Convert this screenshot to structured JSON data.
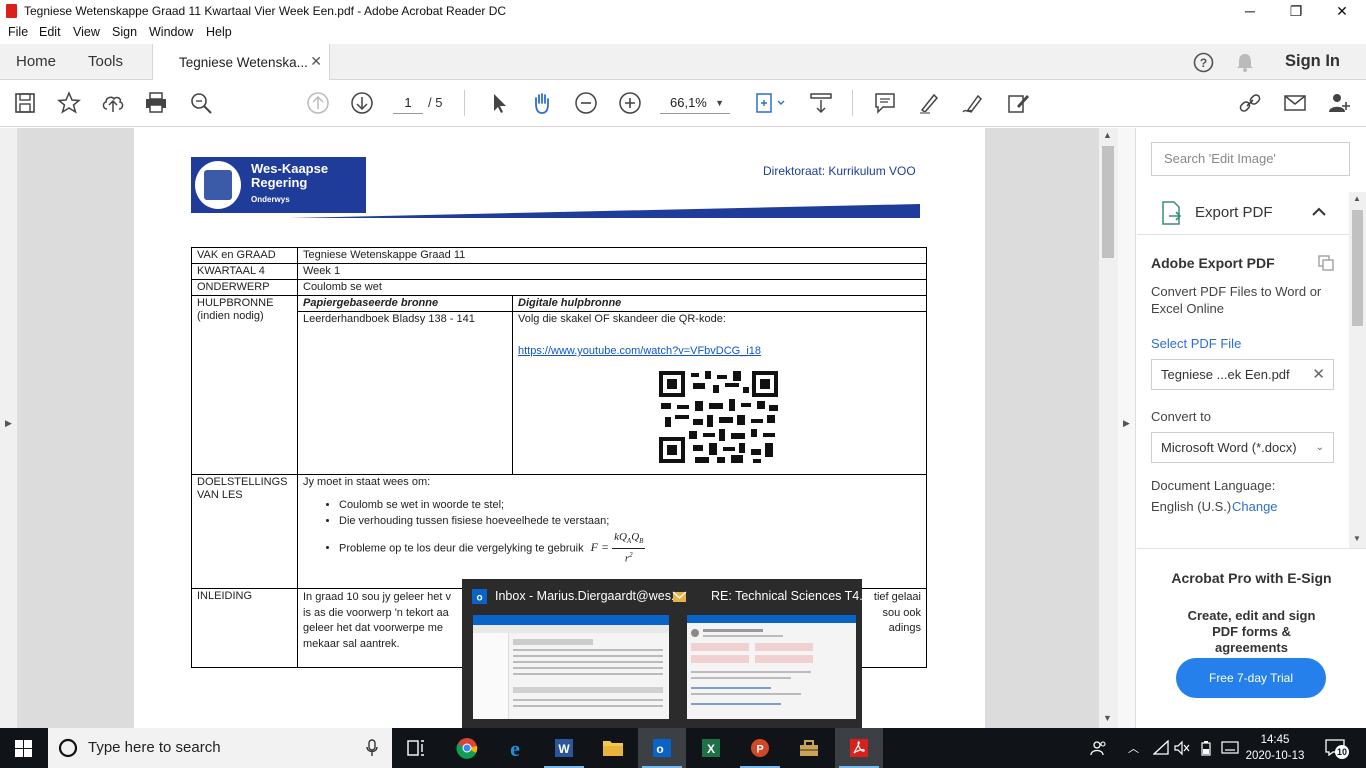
{
  "window": {
    "title": "Tegniese Wetenskappe Graad 11 Kwartaal Vier Week Een.pdf - Adobe Acrobat Reader DC",
    "minimize": "─",
    "maximize": "❐",
    "close": "✕"
  },
  "menu": [
    "File",
    "Edit",
    "View",
    "Sign",
    "Window",
    "Help"
  ],
  "tabs": {
    "home": "Home",
    "tools": "Tools",
    "doc": "Tegniese Wetenska...",
    "doc_close": "✕",
    "sign_in": "Sign In"
  },
  "toolbar": {
    "page_current": "1",
    "page_total": "/ 5",
    "zoom": "66,1%"
  },
  "pdf": {
    "logo_line1": "Wes-Kaapse",
    "logo_line2": "Regering",
    "logo_line3": "Onderwys",
    "directorate": "Direktoraat: Kurrikulum VOO",
    "rows": {
      "vak_label": "VAK en GRAAD",
      "vak_value": "Tegniese Wetenskappe Graad 11",
      "kwartaal_label": "KWARTAAL 4",
      "kwartaal_value": "Week 1",
      "onderwerp_label": "ONDERWERP",
      "onderwerp_value": "Coulomb se wet",
      "hulp_label1": "HULPBRONNE",
      "hulp_label2": "(indien nodig)",
      "paper_head": "Papiergebaseerde bronne",
      "digital_head": "Digitale hulpbronne",
      "paper_value": "Leerderhandboek Bladsy 138 - 141",
      "digital_instr": "Volg die skakel OF skandeer die QR-kode:",
      "digital_link": "https://www.youtube.com/watch?v=VFbvDCG_i18",
      "doel_label1": "DOELSTELLINGS",
      "doel_label2": "VAN LES",
      "doel_intro": "Jy moet in staat wees om:",
      "doel_items": [
        "Coulomb se wet in woorde te stel;",
        "Die verhouding tussen fisiese hoeveelhede te verstaan;",
        "Probleme op te los deur die vergelyking te gebruik"
      ],
      "formula_f": "F =",
      "formula_num": "kQ",
      "formula_den": "r",
      "inleiding_label": "INLEIDING",
      "inleiding_l1_a": "In graad 10 sou jy geleer het v",
      "inleiding_l1_b": "tief gelaai",
      "inleiding_l2_a": "is as die voorwerp 'n tekort aa",
      "inleiding_l2_b": "sou ook",
      "inleiding_l3_a": "geleer het dat voorwerpe me",
      "inleiding_l3_b": "adings",
      "inleiding_l4": "mekaar sal aantrek."
    }
  },
  "right_panel": {
    "search_placeholder": "Search 'Edit Image'",
    "export_title": "Export PDF",
    "adobe_export": "Adobe Export PDF",
    "convert_desc": "Convert PDF Files to Word or Excel Online",
    "select_file": "Select PDF File",
    "file_name": "Tegniese ...ek Een.pdf",
    "convert_to": "Convert to",
    "format": "Microsoft Word (*.docx)",
    "doc_language": "Document Language:",
    "language": "English (U.S.)",
    "change": "Change",
    "pro_title": "Acrobat Pro with E-Sign",
    "pro_desc": "Create, edit and sign PDF forms & agreements",
    "trial_button": "Free 7-day Trial"
  },
  "thumbnails": [
    {
      "caption": "Inbox - Marius.Diergaardt@wes..."
    },
    {
      "caption": "RE: Technical Sciences T4..."
    }
  ],
  "taskbar": {
    "search_placeholder": "Type here to search",
    "time": "14:45",
    "date": "2020-10-13",
    "notifications": "10"
  },
  "colors": {
    "accent_blue": "#2680eb",
    "wcg_blue": "#1f3c9a",
    "acrobat_red": "#d9201a",
    "taskbar": "#101418"
  }
}
